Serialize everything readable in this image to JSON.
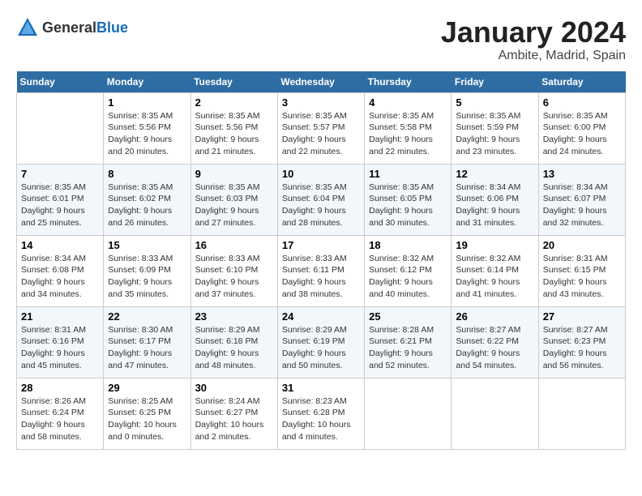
{
  "header": {
    "logo_general": "General",
    "logo_blue": "Blue",
    "month": "January 2024",
    "location": "Ambite, Madrid, Spain"
  },
  "weekdays": [
    "Sunday",
    "Monday",
    "Tuesday",
    "Wednesday",
    "Thursday",
    "Friday",
    "Saturday"
  ],
  "weeks": [
    [
      {
        "day": "",
        "sunrise": "",
        "sunset": "",
        "daylight": ""
      },
      {
        "day": "1",
        "sunrise": "Sunrise: 8:35 AM",
        "sunset": "Sunset: 5:56 PM",
        "daylight": "Daylight: 9 hours and 20 minutes."
      },
      {
        "day": "2",
        "sunrise": "Sunrise: 8:35 AM",
        "sunset": "Sunset: 5:56 PM",
        "daylight": "Daylight: 9 hours and 21 minutes."
      },
      {
        "day": "3",
        "sunrise": "Sunrise: 8:35 AM",
        "sunset": "Sunset: 5:57 PM",
        "daylight": "Daylight: 9 hours and 22 minutes."
      },
      {
        "day": "4",
        "sunrise": "Sunrise: 8:35 AM",
        "sunset": "Sunset: 5:58 PM",
        "daylight": "Daylight: 9 hours and 22 minutes."
      },
      {
        "day": "5",
        "sunrise": "Sunrise: 8:35 AM",
        "sunset": "Sunset: 5:59 PM",
        "daylight": "Daylight: 9 hours and 23 minutes."
      },
      {
        "day": "6",
        "sunrise": "Sunrise: 8:35 AM",
        "sunset": "Sunset: 6:00 PM",
        "daylight": "Daylight: 9 hours and 24 minutes."
      }
    ],
    [
      {
        "day": "7",
        "sunrise": "Sunrise: 8:35 AM",
        "sunset": "Sunset: 6:01 PM",
        "daylight": "Daylight: 9 hours and 25 minutes."
      },
      {
        "day": "8",
        "sunrise": "Sunrise: 8:35 AM",
        "sunset": "Sunset: 6:02 PM",
        "daylight": "Daylight: 9 hours and 26 minutes."
      },
      {
        "day": "9",
        "sunrise": "Sunrise: 8:35 AM",
        "sunset": "Sunset: 6:03 PM",
        "daylight": "Daylight: 9 hours and 27 minutes."
      },
      {
        "day": "10",
        "sunrise": "Sunrise: 8:35 AM",
        "sunset": "Sunset: 6:04 PM",
        "daylight": "Daylight: 9 hours and 28 minutes."
      },
      {
        "day": "11",
        "sunrise": "Sunrise: 8:35 AM",
        "sunset": "Sunset: 6:05 PM",
        "daylight": "Daylight: 9 hours and 30 minutes."
      },
      {
        "day": "12",
        "sunrise": "Sunrise: 8:34 AM",
        "sunset": "Sunset: 6:06 PM",
        "daylight": "Daylight: 9 hours and 31 minutes."
      },
      {
        "day": "13",
        "sunrise": "Sunrise: 8:34 AM",
        "sunset": "Sunset: 6:07 PM",
        "daylight": "Daylight: 9 hours and 32 minutes."
      }
    ],
    [
      {
        "day": "14",
        "sunrise": "Sunrise: 8:34 AM",
        "sunset": "Sunset: 6:08 PM",
        "daylight": "Daylight: 9 hours and 34 minutes."
      },
      {
        "day": "15",
        "sunrise": "Sunrise: 8:33 AM",
        "sunset": "Sunset: 6:09 PM",
        "daylight": "Daylight: 9 hours and 35 minutes."
      },
      {
        "day": "16",
        "sunrise": "Sunrise: 8:33 AM",
        "sunset": "Sunset: 6:10 PM",
        "daylight": "Daylight: 9 hours and 37 minutes."
      },
      {
        "day": "17",
        "sunrise": "Sunrise: 8:33 AM",
        "sunset": "Sunset: 6:11 PM",
        "daylight": "Daylight: 9 hours and 38 minutes."
      },
      {
        "day": "18",
        "sunrise": "Sunrise: 8:32 AM",
        "sunset": "Sunset: 6:12 PM",
        "daylight": "Daylight: 9 hours and 40 minutes."
      },
      {
        "day": "19",
        "sunrise": "Sunrise: 8:32 AM",
        "sunset": "Sunset: 6:14 PM",
        "daylight": "Daylight: 9 hours and 41 minutes."
      },
      {
        "day": "20",
        "sunrise": "Sunrise: 8:31 AM",
        "sunset": "Sunset: 6:15 PM",
        "daylight": "Daylight: 9 hours and 43 minutes."
      }
    ],
    [
      {
        "day": "21",
        "sunrise": "Sunrise: 8:31 AM",
        "sunset": "Sunset: 6:16 PM",
        "daylight": "Daylight: 9 hours and 45 minutes."
      },
      {
        "day": "22",
        "sunrise": "Sunrise: 8:30 AM",
        "sunset": "Sunset: 6:17 PM",
        "daylight": "Daylight: 9 hours and 47 minutes."
      },
      {
        "day": "23",
        "sunrise": "Sunrise: 8:29 AM",
        "sunset": "Sunset: 6:18 PM",
        "daylight": "Daylight: 9 hours and 48 minutes."
      },
      {
        "day": "24",
        "sunrise": "Sunrise: 8:29 AM",
        "sunset": "Sunset: 6:19 PM",
        "daylight": "Daylight: 9 hours and 50 minutes."
      },
      {
        "day": "25",
        "sunrise": "Sunrise: 8:28 AM",
        "sunset": "Sunset: 6:21 PM",
        "daylight": "Daylight: 9 hours and 52 minutes."
      },
      {
        "day": "26",
        "sunrise": "Sunrise: 8:27 AM",
        "sunset": "Sunset: 6:22 PM",
        "daylight": "Daylight: 9 hours and 54 minutes."
      },
      {
        "day": "27",
        "sunrise": "Sunrise: 8:27 AM",
        "sunset": "Sunset: 6:23 PM",
        "daylight": "Daylight: 9 hours and 56 minutes."
      }
    ],
    [
      {
        "day": "28",
        "sunrise": "Sunrise: 8:26 AM",
        "sunset": "Sunset: 6:24 PM",
        "daylight": "Daylight: 9 hours and 58 minutes."
      },
      {
        "day": "29",
        "sunrise": "Sunrise: 8:25 AM",
        "sunset": "Sunset: 6:25 PM",
        "daylight": "Daylight: 10 hours and 0 minutes."
      },
      {
        "day": "30",
        "sunrise": "Sunrise: 8:24 AM",
        "sunset": "Sunset: 6:27 PM",
        "daylight": "Daylight: 10 hours and 2 minutes."
      },
      {
        "day": "31",
        "sunrise": "Sunrise: 8:23 AM",
        "sunset": "Sunset: 6:28 PM",
        "daylight": "Daylight: 10 hours and 4 minutes."
      },
      {
        "day": "",
        "sunrise": "",
        "sunset": "",
        "daylight": ""
      },
      {
        "day": "",
        "sunrise": "",
        "sunset": "",
        "daylight": ""
      },
      {
        "day": "",
        "sunrise": "",
        "sunset": "",
        "daylight": ""
      }
    ]
  ]
}
